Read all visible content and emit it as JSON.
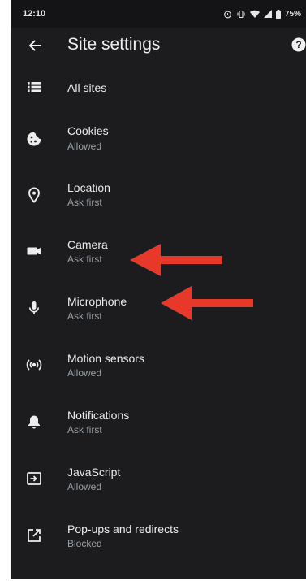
{
  "status_bar": {
    "time": "12:10",
    "battery": "75%"
  },
  "header": {
    "title": "Site settings"
  },
  "items": [
    {
      "label": "All sites"
    },
    {
      "label": "Cookies",
      "status": "Allowed"
    },
    {
      "label": "Location",
      "status": "Ask first"
    },
    {
      "label": "Camera",
      "status": "Ask first"
    },
    {
      "label": "Microphone",
      "status": "Ask first"
    },
    {
      "label": "Motion sensors",
      "status": "Allowed"
    },
    {
      "label": "Notifications",
      "status": "Ask first"
    },
    {
      "label": "JavaScript",
      "status": "Allowed"
    },
    {
      "label": "Pop-ups and redirects",
      "status": "Blocked"
    }
  ],
  "colors": {
    "background": "#1c1c1e",
    "arrow": "#e8382a",
    "text": "#ededed",
    "subtext": "#9aa0a6"
  }
}
